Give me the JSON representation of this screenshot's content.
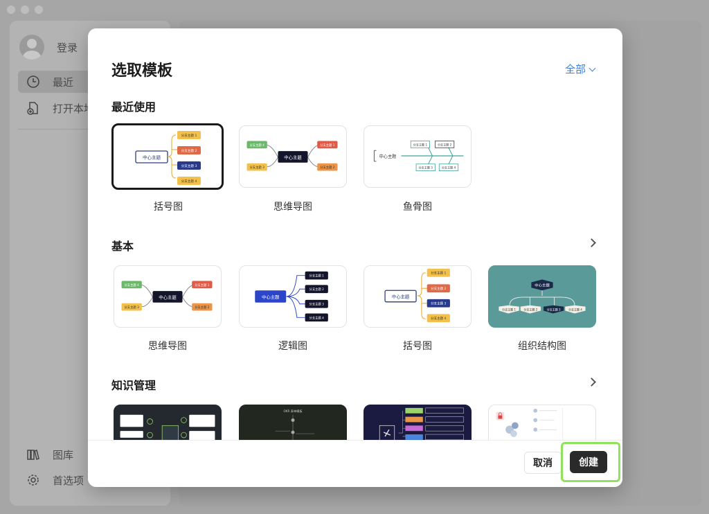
{
  "sidebar": {
    "login_label": "登录",
    "items": [
      {
        "label": "最近",
        "icon": "clock-icon"
      },
      {
        "label": "打开本地",
        "icon": "open-file-icon"
      },
      {
        "label": "图库",
        "icon": "library-icon"
      },
      {
        "label": "首选项",
        "icon": "gear-icon"
      }
    ]
  },
  "dialog": {
    "title": "选取模板",
    "filter_label": "全部",
    "sections": [
      {
        "title": "最近使用",
        "templates": [
          "括号图",
          "思维导图",
          "鱼骨图"
        ]
      },
      {
        "title": "基本",
        "templates": [
          "思维导图",
          "逻辑图",
          "括号图",
          "组织结构图"
        ]
      },
      {
        "title": "知识管理",
        "templates": [
          "",
          "",
          "",
          ""
        ]
      }
    ],
    "thumb_text": {
      "center": "中心主题",
      "branch1": "分支主题 1",
      "branch2": "分支主题 2",
      "branch3": "分支主题 3",
      "branch4": "分支主题 4",
      "okr": "OKR 表单模板"
    },
    "cancel_label": "取消",
    "create_label": "创建"
  },
  "colors": {
    "accent": "#3b82d6",
    "create_bg": "#2a2a2a",
    "highlight": "#8fe25a"
  }
}
